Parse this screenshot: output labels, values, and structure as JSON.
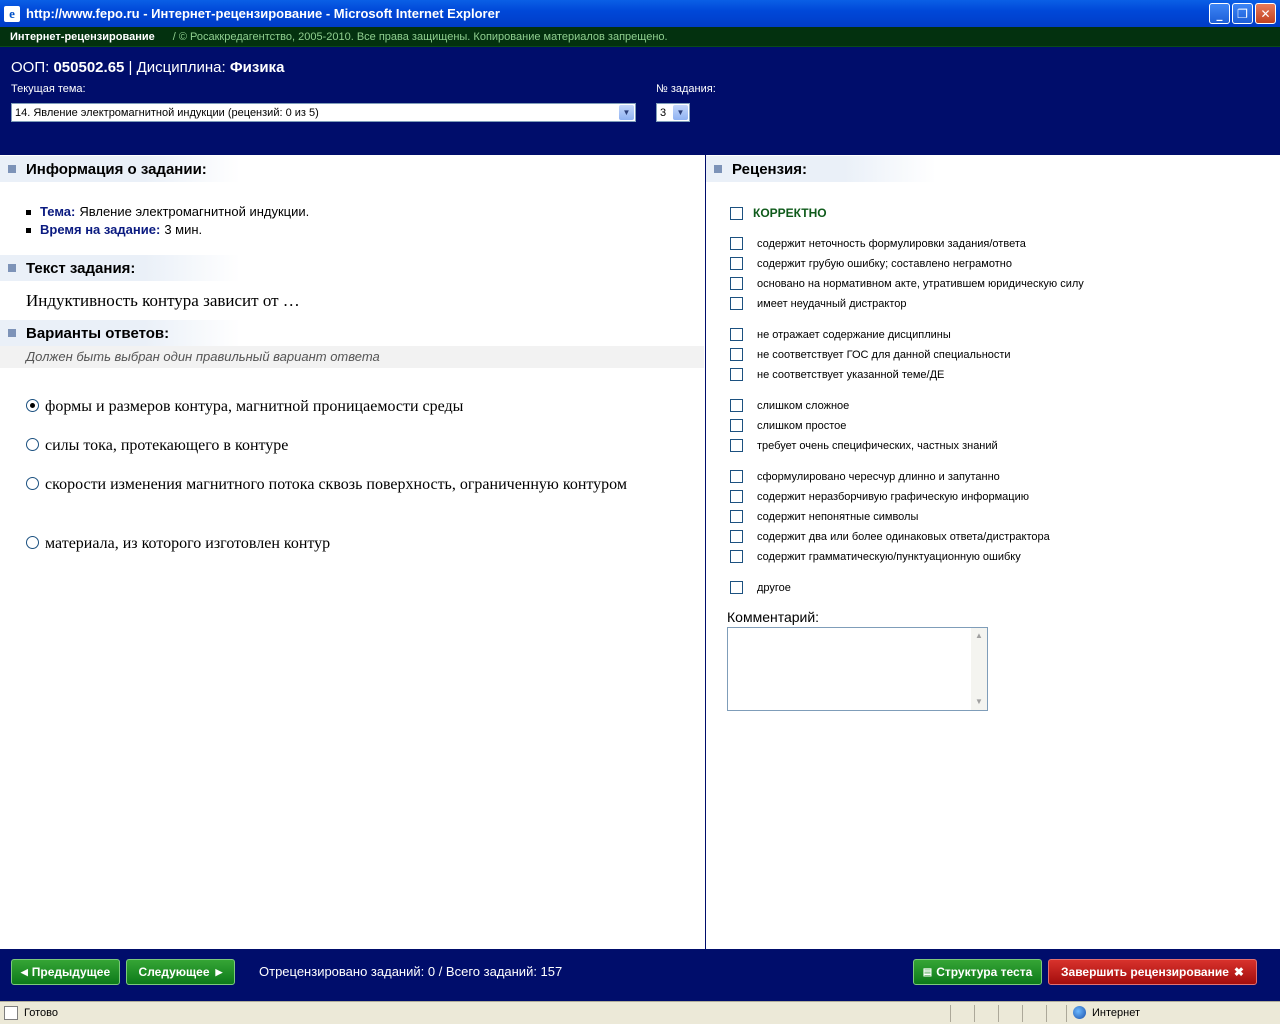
{
  "window": {
    "title": "http://www.fepo.ru - Интернет-рецензирование - Microsoft Internet Explorer"
  },
  "topbar": {
    "app_name": "Интернет-рецензирование",
    "copyright": "/ © Росаккредагентство, 2005-2010. Все права защищены. Копирование материалов запрещено."
  },
  "header": {
    "oop_label": "ООП:",
    "oop_value": "050502.65",
    "separator": "|",
    "discipline_label": "Дисциплина:",
    "discipline_value": "Физика",
    "topic_label": "Текущая тема:",
    "topic_value": "14. Явление электромагнитной индукции  (рецензий: 0 из 5)",
    "task_no_label": "№ задания:",
    "task_no_value": "3"
  },
  "info": {
    "title": "Информация о задании:",
    "topic_label": "Тема:",
    "topic_value": "Явление электромагнитной индукции.",
    "time_label": "Время на задание:",
    "time_value": "3 мин."
  },
  "task": {
    "title": "Текст задания:",
    "text": "Индуктивность контура зависит от …"
  },
  "answers": {
    "title": "Варианты ответов:",
    "hint": "Должен быть выбран один правильный вариант ответа",
    "options": [
      {
        "text": "формы и размеров контура, магнитной проницаемости среды",
        "selected": true
      },
      {
        "text": "силы тока, протекающего в контуре",
        "selected": false
      },
      {
        "text": "скорости изменения магнитного потока сквозь поверхность, ограниченную контуром",
        "selected": false
      },
      {
        "text": "материала, из которого изготовлен контур",
        "selected": false
      }
    ]
  },
  "review": {
    "title": "Рецензия:",
    "correct_label": "КОРРЕКТНО",
    "items": [
      "содержит неточность формулировки задания/ответа",
      "содержит грубую ошибку; составлено неграмотно",
      "основано на нормативном акте, утратившем юридическую силу",
      "имеет неудачный дистрактор",
      "не отражает содержание дисциплины",
      "не соответствует ГОС для данной специальности",
      "не соответствует указанной теме/ДЕ",
      "слишком сложное",
      "слишком простое",
      "требует очень специфических, частных знаний",
      "сформулировано чересчур длинно и запутанно",
      "содержит неразборчивую графическую информацию",
      "содержит непонятные символы",
      "содержит два или более одинаковых ответа/дистрактора",
      "содержит грамматическую/пунктуационную ошибку",
      "другое"
    ],
    "comment_label": "Комментарий:"
  },
  "footer": {
    "prev_label": "Предыдущее",
    "next_label": "Следующее",
    "reviewed_text": "Отрецензировано заданий: 0 / Всего заданий: 157",
    "structure_label": "Структура теста",
    "finish_label": "Завершить рецензирование"
  },
  "statusbar": {
    "status": "Готово",
    "zone": "Интернет"
  }
}
